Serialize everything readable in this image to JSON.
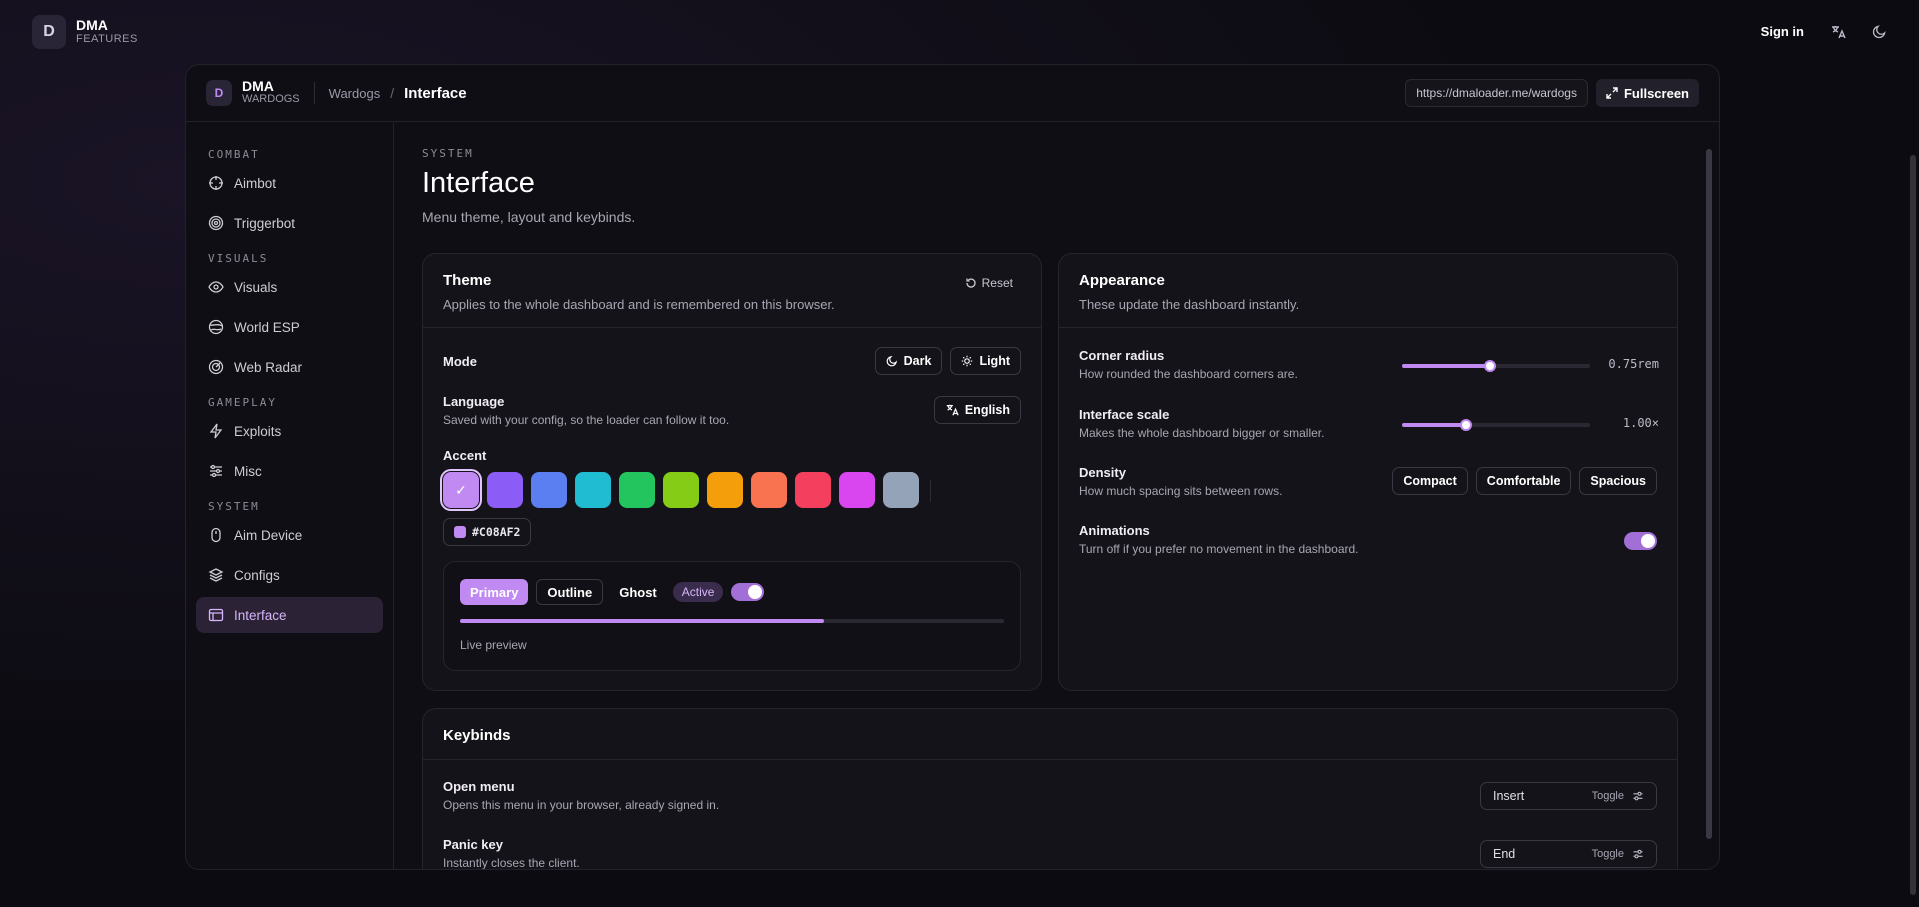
{
  "topbar": {
    "logo_letter": "D",
    "brand_title": "DMA",
    "brand_subtitle": "FEATURES",
    "signin": "Sign in"
  },
  "frame": {
    "logo_letter": "D",
    "brand_title": "DMA",
    "brand_subtitle": "WARDOGS",
    "breadcrumb": [
      "Wardogs",
      "/",
      "Interface"
    ],
    "url": "https://dmaloader.me/wardogs",
    "fullscreen": "Fullscreen"
  },
  "sidebar": {
    "sections": [
      {
        "title": "COMBAT",
        "items": [
          {
            "label": "Aimbot",
            "icon": "crosshair-icon"
          },
          {
            "label": "Triggerbot",
            "icon": "target-icon"
          }
        ]
      },
      {
        "title": "VISUALS",
        "items": [
          {
            "label": "Visuals",
            "icon": "eye-icon"
          },
          {
            "label": "World ESP",
            "icon": "globe-icon"
          },
          {
            "label": "Web Radar",
            "icon": "radar-icon"
          }
        ]
      },
      {
        "title": "GAMEPLAY",
        "items": [
          {
            "label": "Exploits",
            "icon": "bolt-icon"
          },
          {
            "label": "Misc",
            "icon": "sliders-icon"
          }
        ]
      },
      {
        "title": "SYSTEM",
        "items": [
          {
            "label": "Aim Device",
            "icon": "mouse-icon"
          },
          {
            "label": "Configs",
            "icon": "layers-icon"
          },
          {
            "label": "Interface",
            "icon": "window-icon",
            "active": true
          }
        ]
      }
    ]
  },
  "page": {
    "section": "SYSTEM",
    "title": "Interface",
    "subtitle": "Menu theme, layout and keybinds."
  },
  "theme": {
    "title": "Theme",
    "subtitle": "Applies to the whole dashboard and is remembered on this browser.",
    "reset": "Reset",
    "mode_label": "Mode",
    "mode_dark": "Dark",
    "mode_light": "Light",
    "language_label": "Language",
    "language_desc": "Saved with your config, so the loader can follow it too.",
    "language_value": "English",
    "accent_label": "Accent",
    "swatches": [
      "#c08af2",
      "#8b5cf6",
      "#5b7ff0",
      "#1fbcd2",
      "#22c55e",
      "#84cc16",
      "#f59e0b",
      "#f97350",
      "#f43f5e",
      "#d946ef",
      "#94a3b8"
    ],
    "accent_hex": "#C08AF2",
    "preview": {
      "primary": "Primary",
      "outline": "Outline",
      "ghost": "Ghost",
      "active": "Active",
      "progress": 0.67,
      "caption": "Live preview"
    }
  },
  "appearance": {
    "title": "Appearance",
    "subtitle": "These update the dashboard instantly.",
    "corner_label": "Corner radius",
    "corner_desc": "How rounded the dashboard corners are.",
    "corner_value": "0.75rem",
    "corner_fraction": 0.47,
    "scale_label": "Interface scale",
    "scale_desc": "Makes the whole dashboard bigger or smaller.",
    "scale_value": "1.00×",
    "scale_fraction": 0.34,
    "density_label": "Density",
    "density_desc": "How much spacing sits between rows.",
    "density_options": [
      "Compact",
      "Comfortable",
      "Spacious"
    ],
    "animations_label": "Animations",
    "animations_desc": "Turn off if you prefer no movement in the dashboard.",
    "animations_on": true
  },
  "keybinds": {
    "title": "Keybinds",
    "rows": [
      {
        "label": "Open menu",
        "desc": "Opens this menu in your browser, already signed in.",
        "key": "Insert",
        "mode": "Toggle"
      },
      {
        "label": "Panic key",
        "desc": "Instantly closes the client.",
        "key": "End",
        "mode": "Toggle"
      }
    ]
  }
}
